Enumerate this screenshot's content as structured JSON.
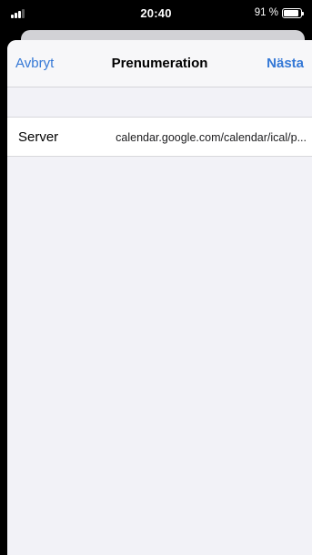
{
  "status_bar": {
    "time": "20:40",
    "battery_percent": "91 %",
    "battery_level": 0.91
  },
  "nav": {
    "cancel_label": "Avbryt",
    "title": "Prenumeration",
    "next_label": "Nästa"
  },
  "form": {
    "server_label": "Server",
    "server_value": "calendar.google.com/calendar/ical/p..."
  },
  "colors": {
    "accent": "#3478d6",
    "background": "#f2f2f7"
  }
}
